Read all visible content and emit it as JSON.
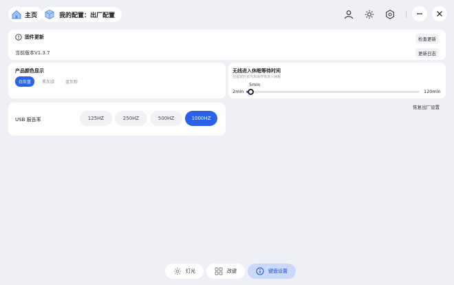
{
  "header": {
    "home_label": "主页",
    "config_label": "我的配置：出厂配置",
    "icons": [
      "user-icon",
      "brightness-icon",
      "settings-icon"
    ],
    "minimize_icon": "minimize-icon",
    "close_icon": "close-icon"
  },
  "firmware": {
    "title": "固件更新",
    "check_label": "检查更新",
    "version_text": "当前版本V1.3.7",
    "changelog_label": "更新日志"
  },
  "product_color": {
    "title": "产品颜色显示",
    "options": [
      "白灰蓝",
      "黑灰绿",
      "蓝灰粉"
    ],
    "selected": "白灰蓝",
    "accent": "#2b63e8"
  },
  "sleep": {
    "title": "无线进入休眠等待时间",
    "subtitle": "在指定时长内未操作将进入休眠",
    "current_label": "5min",
    "min_label": "2min",
    "max_label": "120min",
    "min": 2,
    "max": 120,
    "value": 5
  },
  "factory_reset_label": "恢复出厂设置",
  "usb": {
    "label": "USB 报告率",
    "options": [
      "125HZ",
      "250HZ",
      "500HZ",
      "1000HZ"
    ],
    "selected": "1000HZ"
  },
  "bottom_nav": {
    "items": [
      {
        "label": "灯光",
        "icon": "light-icon",
        "active": false
      },
      {
        "label": "改键",
        "icon": "keys-grid-icon",
        "active": false
      },
      {
        "label": "键盘设置",
        "icon": "info-icon",
        "active": true
      }
    ]
  }
}
